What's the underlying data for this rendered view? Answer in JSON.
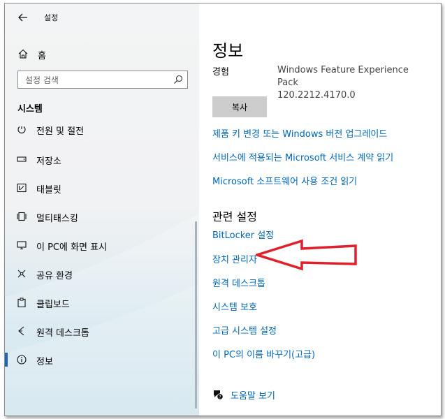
{
  "window": {
    "title": "설정"
  },
  "sidebar": {
    "home_label": "홈",
    "search": {
      "placeholder": "설정 검색"
    },
    "section_title": "시스템",
    "items": [
      {
        "label": "전원 및 절전",
        "icon": "power-icon",
        "partial": true
      },
      {
        "label": "저장소",
        "icon": "storage-icon"
      },
      {
        "label": "태블릿",
        "icon": "tablet-icon"
      },
      {
        "label": "멀티태스킹",
        "icon": "multitasking-icon"
      },
      {
        "label": "이 PC에 화면 표시",
        "icon": "project-icon"
      },
      {
        "label": "공유 환경",
        "icon": "share-icon"
      },
      {
        "label": "클립보드",
        "icon": "clipboard-icon"
      },
      {
        "label": "원격 데스크톱",
        "icon": "remote-desktop-icon"
      },
      {
        "label": "정보",
        "icon": "info-icon",
        "active": true
      }
    ]
  },
  "main": {
    "page_title": "정보",
    "experience": {
      "label": "경험",
      "value_line1": "Windows Feature Experience Pack",
      "value_line2": "120.2212.4170.0"
    },
    "copy_button": "복사",
    "top_links": [
      "제품 키 변경 또는 Windows 버전 업그레이드",
      "서비스에 적용되는 Microsoft 서비스 계약 읽기",
      "Microsoft 소프트웨어 사용 조건 읽기"
    ],
    "related_title": "관련 설정",
    "related_links": [
      "BitLocker 설정",
      "장치 관리자",
      "원격 데스크톱",
      "시스템 보호",
      "고급 시스템 설정",
      "이 PC의 이름 바꾸기(고급)"
    ],
    "help_link": "도움말 보기"
  },
  "colors": {
    "link": "#0067b8",
    "annotation_arrow": "#e0202a",
    "selection_bar": "#1e64b0"
  }
}
